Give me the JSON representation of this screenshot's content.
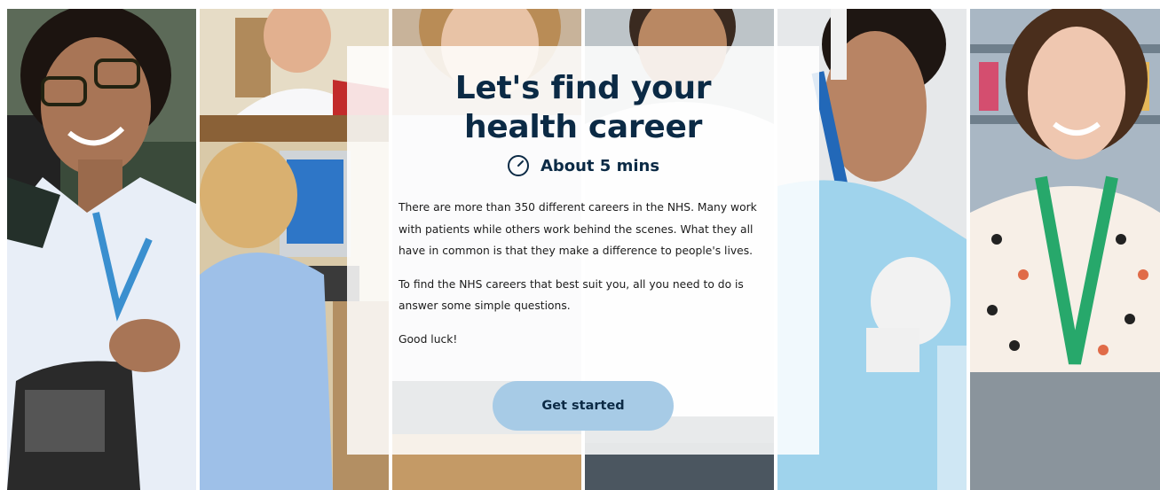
{
  "hero": {
    "title": "Let's find your health career",
    "duration": "About 5 mins",
    "paragraphs": [
      "There are more than 350 different careers in the NHS. Many work with patients while others work behind the scenes. What they all have in common is that they make a difference to people's lives.",
      "To find the NHS careers that best suit you, all you need to do is answer some simple questions.",
      "Good luck!"
    ],
    "cta_label": "Get started"
  },
  "icons": {
    "duration": "clock-icon"
  },
  "colors": {
    "title": "#0b2a45",
    "button_bg": "#a7cbe6"
  }
}
